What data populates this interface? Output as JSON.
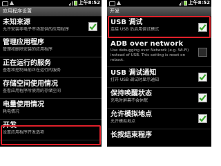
{
  "left": {
    "status_time": "上午8:52",
    "title": "应用程序设置",
    "items": [
      {
        "title": "未知来源",
        "subtitle": "允许安装非电子市场提供的应用程序",
        "checked": true
      },
      {
        "title": "管理应用程序",
        "subtitle": "管理和删除安装的应用程序"
      },
      {
        "title": "正在运行的服务",
        "subtitle": "查看和控制当前正在运行的服务"
      },
      {
        "title": "存储空间使用情况",
        "subtitle": "查看应用程序所使用的存储空间"
      },
      {
        "title": "电量使用情况",
        "subtitle": "耗电情况"
      },
      {
        "title": "开发",
        "subtitle": "设置应用程序开发选项"
      }
    ]
  },
  "right": {
    "status_time": "上午8:52",
    "title": "开发",
    "items": [
      {
        "title": "USB 调试",
        "subtitle": "连接 USB 后启用调试模式",
        "checked": true
      },
      {
        "title": "ADB over network",
        "subtitle": "Use debugging over Network (e.g. Wi-Fi) instead of USB. This setting is reset on reboot."
      },
      {
        "title": "USB 调试通知",
        "subtitle": "打开 USB 调试时显示通知",
        "checked": true
      },
      {
        "title": "保持唤醒状态",
        "subtitle": "充电时屏幕不会休眠",
        "checked": true
      },
      {
        "title": "允许模拟地点",
        "subtitle": "允许模拟地点",
        "checked": true
      },
      {
        "title": "长按结束程序",
        "subtitle": ""
      }
    ]
  },
  "colors": {
    "highlight": "#e0202a",
    "checkmark": "#3aa52a",
    "titlebar": "#4a4a4a"
  }
}
